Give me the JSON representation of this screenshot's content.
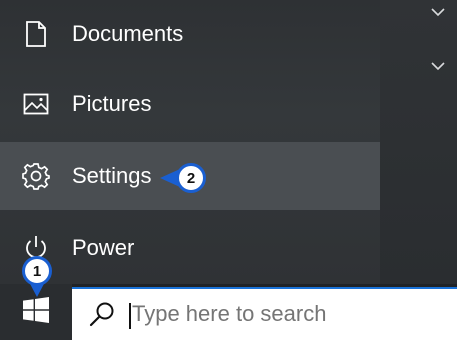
{
  "menu": {
    "items": [
      {
        "label": "Documents",
        "icon": "document-icon"
      },
      {
        "label": "Pictures",
        "icon": "pictures-icon"
      },
      {
        "label": "Settings",
        "icon": "gear-icon"
      },
      {
        "label": "Power",
        "icon": "power-icon"
      }
    ]
  },
  "taskbar": {
    "start_icon": "windows-logo-icon",
    "search_placeholder": "Type here to search"
  },
  "callouts": [
    {
      "number": "1"
    },
    {
      "number": "2"
    }
  ],
  "colors": {
    "callout_border": "#1a5fd1",
    "search_border": "#1a73d9",
    "menu_hover": "#4a4e52"
  }
}
